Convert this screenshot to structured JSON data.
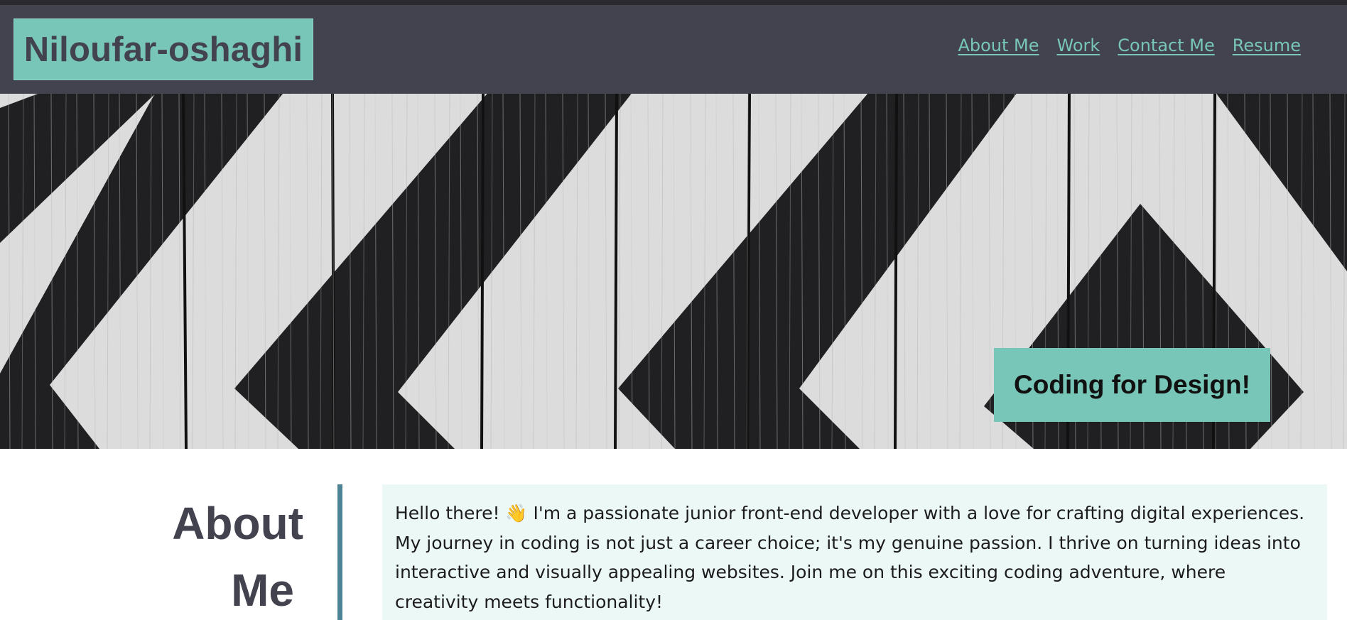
{
  "header": {
    "brand": "Niloufar-oshaghi",
    "nav": [
      {
        "label": "About Me"
      },
      {
        "label": "Work"
      },
      {
        "label": "Contact Me"
      },
      {
        "label": "Resume"
      }
    ]
  },
  "hero": {
    "tagline": "Coding for Design!"
  },
  "about": {
    "title_line1": "About",
    "title_line2": "Me",
    "text": "Hello there! 👋 I'm a passionate junior front-end developer with a love for crafting digital experiences. My journey in coding is not just a career choice; it's my genuine passion. I thrive on turning ideas into interactive and visually appealing websites. Join me on this exciting coding adventure, where creativity meets functionality!"
  },
  "colors": {
    "header_bg": "#434350",
    "accent": "#77c6b8",
    "about_bg": "#ebf8f6",
    "divider": "#4e8496"
  }
}
